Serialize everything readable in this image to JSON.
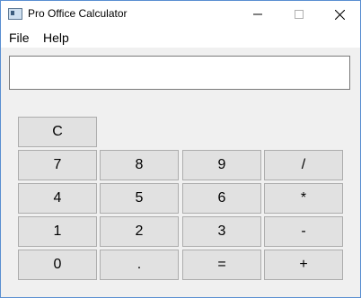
{
  "window": {
    "title": "Pro Office Calculator",
    "icon": "app-window-icon"
  },
  "menu": {
    "file": "File",
    "help": "Help"
  },
  "display": {
    "value": ""
  },
  "keys": {
    "clear": "C",
    "seven": "7",
    "eight": "8",
    "nine": "9",
    "divide": "/",
    "four": "4",
    "five": "5",
    "six": "6",
    "multiply": "*",
    "one": "1",
    "two": "2",
    "three": "3",
    "minus": "-",
    "zero": "0",
    "dot": ".",
    "equals": "=",
    "plus": "+"
  }
}
